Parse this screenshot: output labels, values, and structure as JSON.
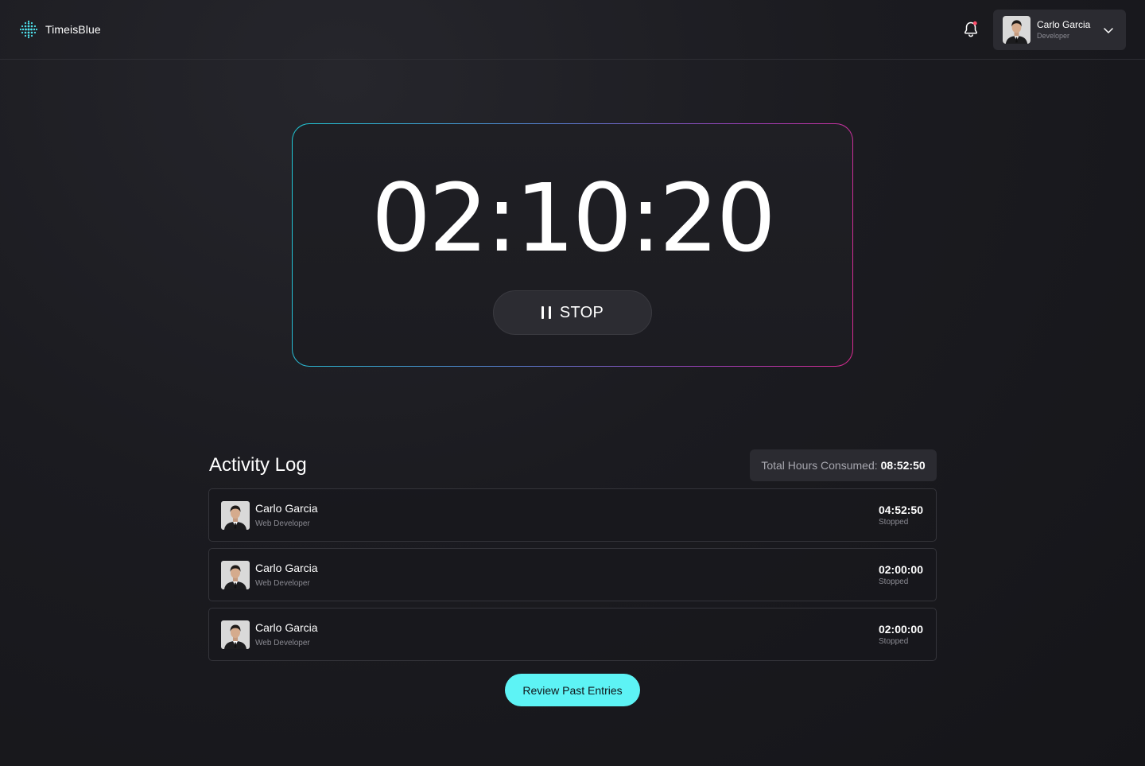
{
  "header": {
    "app_name": "TimeisBlue",
    "logo_icon": "dot-grid-icon",
    "notification_icon": "bell-icon",
    "user": {
      "name": "Carlo Garcia",
      "role": "Developer"
    },
    "dropdown_icon": "chevron-down-icon"
  },
  "timer": {
    "value": "02:10:20",
    "stop_label": "STOP",
    "stop_icon": "pause-icon"
  },
  "activity": {
    "title": "Activity Log",
    "total_label": "Total Hours Consumed:",
    "total_value": "08:52:50",
    "entries": [
      {
        "name": "Carlo Garcia",
        "role": "Web Developer",
        "time": "04:52:50",
        "status": "Stopped"
      },
      {
        "name": "Carlo Garcia",
        "role": "Web Developer",
        "time": "02:00:00",
        "status": "Stopped"
      },
      {
        "name": "Carlo Garcia",
        "role": "Web Developer",
        "time": "02:00:00",
        "status": "Stopped"
      }
    ],
    "review_label": "Review Past Entries"
  },
  "colors": {
    "accent": "#5df3f5",
    "gradient_start": "#1fc7d4",
    "gradient_end": "#d92a90",
    "notification_dot": "#ff4d6a",
    "background": "#1b1b20"
  }
}
